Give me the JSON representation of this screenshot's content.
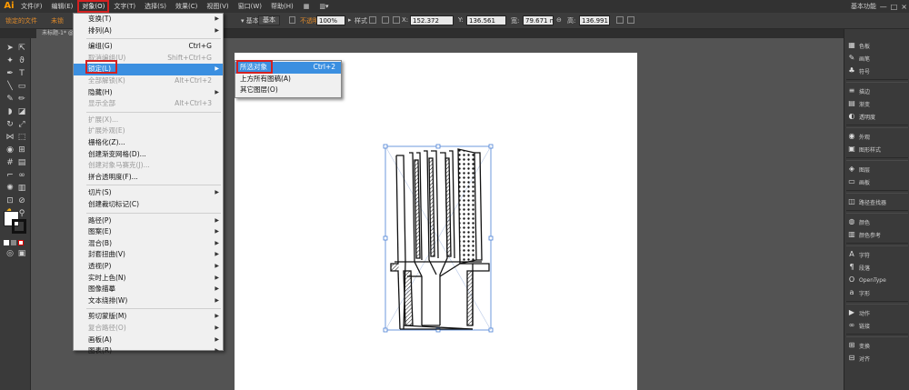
{
  "app": {
    "logo": "Ai"
  },
  "menubar": {
    "items": [
      "文件(F)",
      "编辑(E)",
      "对象(O)",
      "文字(T)",
      "选择(S)",
      "效果(C)",
      "视图(V)",
      "窗口(W)",
      "帮助(H)"
    ],
    "workspace": "基本功能",
    "window_controls": [
      "—",
      "□",
      "×"
    ]
  },
  "controlbar": {
    "left_label1": "锁定的文件",
    "left_label2": "未锁",
    "basic": "基本",
    "style": "样式",
    "opacity_label": "不透明度",
    "opacity_value": "100%",
    "x_value": "152.372",
    "y_value": "136.561",
    "w_value": "79.671 m",
    "h_value": "136.991"
  },
  "document": {
    "tab_title": "未标题-1* @ 300% (RGB/预览)"
  },
  "object_menu": {
    "items": [
      {
        "label": "变换(T)",
        "submenu": true
      },
      {
        "label": "排列(A)",
        "submenu": true
      },
      {
        "sep": true
      },
      {
        "label": "编组(G)",
        "shortcut": "Ctrl+G"
      },
      {
        "label": "取消编组(U)",
        "shortcut": "Shift+Ctrl+G",
        "disabled": true
      },
      {
        "label": "锁定(L)",
        "submenu": true,
        "highlighted": true
      },
      {
        "label": "全部解锁(K)",
        "shortcut": "Alt+Ctrl+2",
        "disabled": true
      },
      {
        "label": "隐藏(H)",
        "submenu": true
      },
      {
        "label": "显示全部",
        "shortcut": "Alt+Ctrl+3",
        "disabled": true
      },
      {
        "sep": true
      },
      {
        "label": "扩展(X)...",
        "disabled": true
      },
      {
        "label": "扩展外观(E)",
        "disabled": true
      },
      {
        "label": "栅格化(Z)..."
      },
      {
        "label": "创建渐变网格(D)..."
      },
      {
        "label": "创建对象马赛克(J)...",
        "disabled": true
      },
      {
        "label": "拼合透明度(F)..."
      },
      {
        "sep": true
      },
      {
        "label": "切片(S)",
        "submenu": true
      },
      {
        "label": "创建裁切标记(C)"
      },
      {
        "sep": true
      },
      {
        "label": "路径(P)",
        "submenu": true
      },
      {
        "label": "图案(E)",
        "submenu": true
      },
      {
        "label": "混合(B)",
        "submenu": true
      },
      {
        "label": "封套扭曲(V)",
        "submenu": true
      },
      {
        "label": "透视(P)",
        "submenu": true
      },
      {
        "label": "实时上色(N)",
        "submenu": true
      },
      {
        "label": "图像描摹",
        "submenu": true
      },
      {
        "label": "文本绕排(W)",
        "submenu": true
      },
      {
        "sep": true
      },
      {
        "label": "剪切蒙版(M)",
        "submenu": true
      },
      {
        "label": "复合路径(O)",
        "submenu": true,
        "disabled": true
      },
      {
        "label": "画板(A)",
        "submenu": true
      },
      {
        "label": "图表(R)",
        "submenu": true
      }
    ]
  },
  "lock_submenu": {
    "items": [
      {
        "label": "所选对象",
        "shortcut": "Ctrl+2",
        "highlighted": true
      },
      {
        "label": "上方所有图稿(A)"
      },
      {
        "label": "其它图层(O)"
      }
    ]
  },
  "panels": {
    "items": [
      {
        "icon": "swatches-icon",
        "label": "色板"
      },
      {
        "icon": "brush-icon",
        "label": "画笔"
      },
      {
        "icon": "symbol-icon",
        "label": "符号"
      },
      {
        "icon": "stroke-icon",
        "label": "描边"
      },
      {
        "icon": "gradient-icon",
        "label": "渐变"
      },
      {
        "icon": "transparency-icon",
        "label": "透明度"
      },
      {
        "icon": "appearance-icon",
        "label": "外观"
      },
      {
        "icon": "graphic-styles-icon",
        "label": "图形样式"
      },
      {
        "icon": "layers-icon",
        "label": "图层"
      },
      {
        "icon": "artboards-icon",
        "label": "画板"
      },
      {
        "icon": "pathfinder-icon",
        "label": "路径查找器"
      },
      {
        "icon": "color-icon",
        "label": "颜色"
      },
      {
        "icon": "color-guide-icon",
        "label": "颜色参考"
      },
      {
        "icon": "character-icon",
        "label": "字符"
      },
      {
        "icon": "paragraph-icon",
        "label": "段落"
      },
      {
        "icon": "opentype-icon",
        "label": "OpenType"
      },
      {
        "icon": "glyphs-icon",
        "label": "字形"
      },
      {
        "icon": "actions-icon",
        "label": "动作"
      },
      {
        "icon": "links-icon",
        "label": "链接"
      },
      {
        "icon": "transform-icon",
        "label": "变换"
      },
      {
        "icon": "align-icon",
        "label": "对齐"
      }
    ]
  }
}
